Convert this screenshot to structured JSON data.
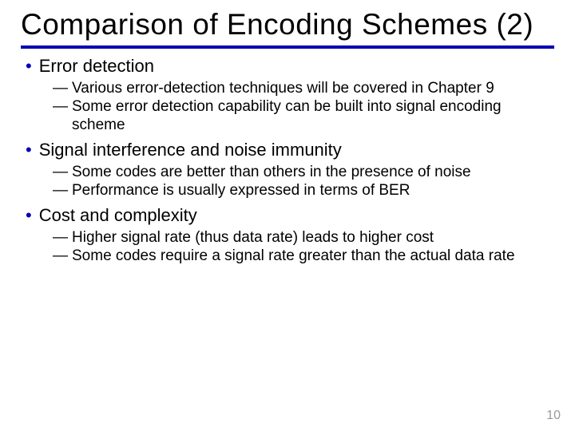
{
  "title": "Comparison of Encoding Schemes (2)",
  "bullets": [
    {
      "label": "Error detection",
      "subs": [
        "Various error-detection techniques will be covered in Chapter 9",
        "Some error detection capability can be built into signal encoding scheme"
      ]
    },
    {
      "label": "Signal interference and noise immunity",
      "subs": [
        "Some codes are better than others in the presence of noise",
        "Performance is usually expressed in terms of BER"
      ]
    },
    {
      "label": "Cost and complexity",
      "subs": [
        "Higher signal rate (thus data rate) leads to higher cost",
        "Some codes require a signal rate greater than the actual data rate"
      ]
    }
  ],
  "dash": "—",
  "dot": "•",
  "page_number": "10"
}
